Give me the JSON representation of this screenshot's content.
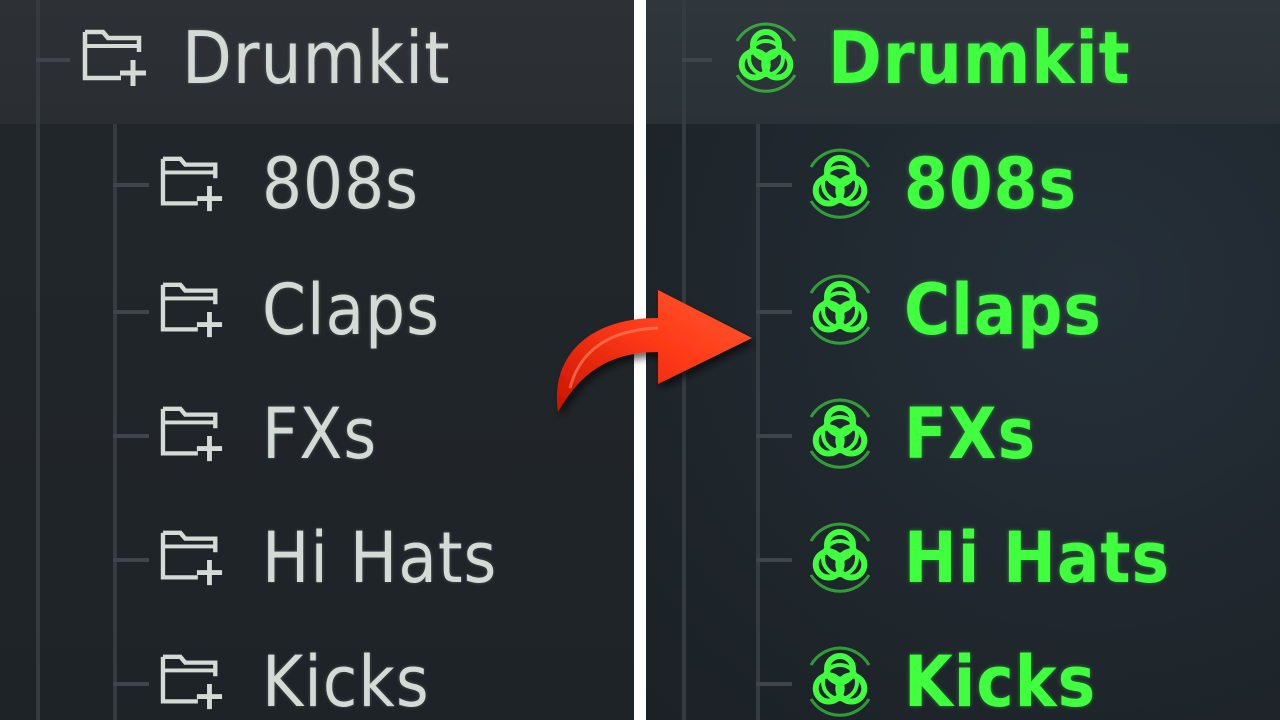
{
  "before_panel": {
    "root": {
      "label": "Drumkit",
      "icon": "folder-plus-icon"
    },
    "children": [
      {
        "label": "808s",
        "icon": "folder-plus-icon"
      },
      {
        "label": "Claps",
        "icon": "folder-plus-icon"
      },
      {
        "label": "FXs",
        "icon": "folder-plus-icon"
      },
      {
        "label": "Hi Hats",
        "icon": "folder-plus-icon"
      },
      {
        "label": "Kicks",
        "icon": "folder-plus-icon"
      }
    ],
    "text_color": "#d4dad6"
  },
  "after_panel": {
    "root": {
      "label": "Drumkit",
      "icon": "biohazard-icon"
    },
    "children": [
      {
        "label": "808s",
        "icon": "biohazard-icon"
      },
      {
        "label": "Claps",
        "icon": "biohazard-icon"
      },
      {
        "label": "FXs",
        "icon": "biohazard-icon"
      },
      {
        "label": "Hi Hats",
        "icon": "biohazard-icon"
      },
      {
        "label": "Kicks",
        "icon": "biohazard-icon"
      }
    ],
    "text_color": "#3fff3f"
  },
  "transition_arrow": {
    "icon": "curved-arrow-icon",
    "color": "#ff2a10"
  },
  "divider_color": "#ffffff"
}
